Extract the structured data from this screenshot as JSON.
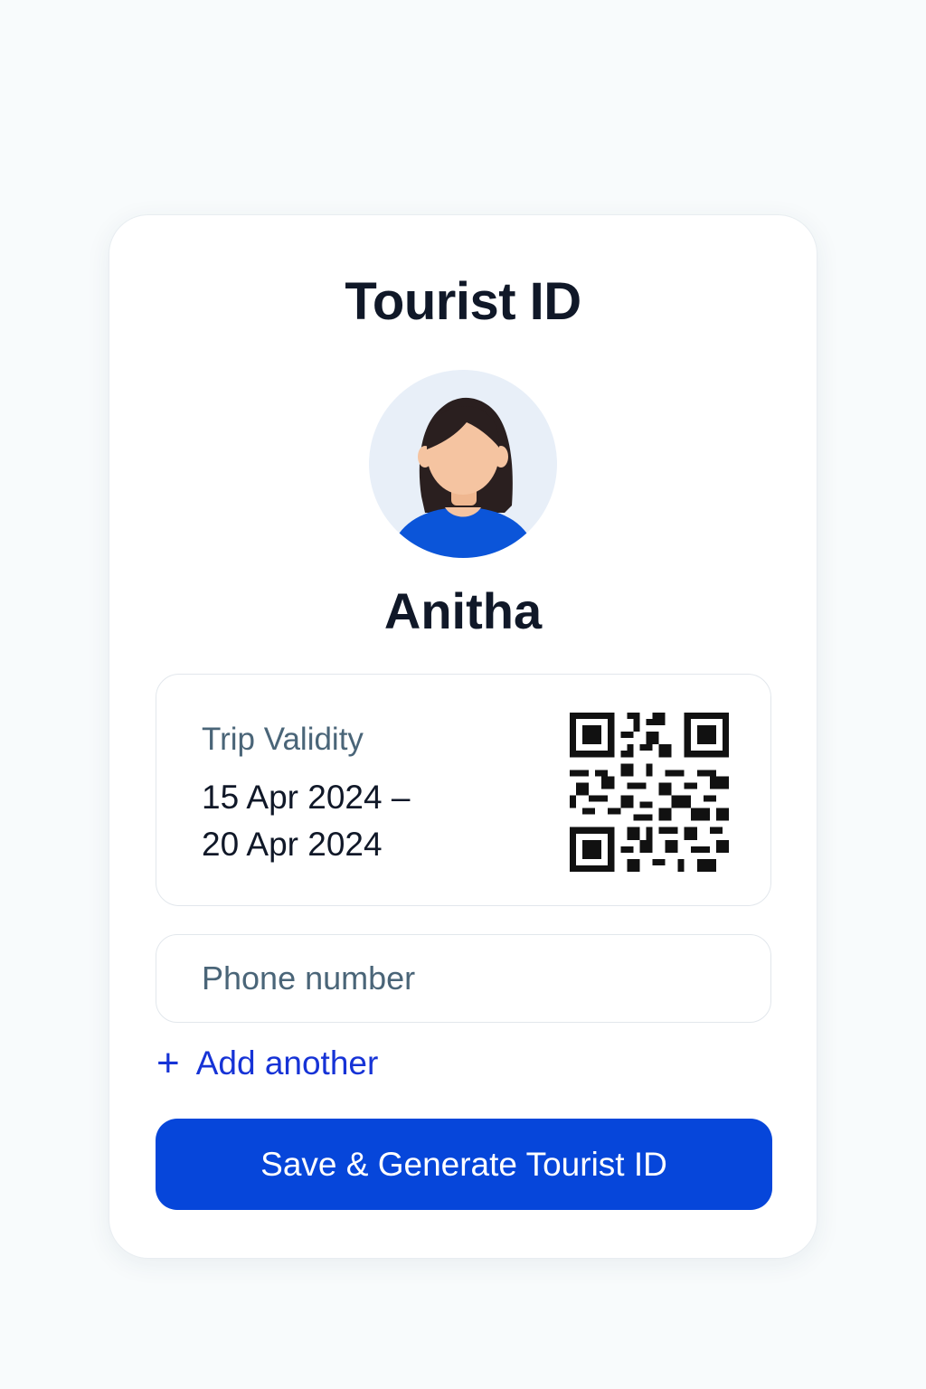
{
  "card": {
    "title": "Tourist ID",
    "user_name": "Anitha"
  },
  "trip": {
    "label": "Trip Validity",
    "start_line": "15 Apr 2024 –",
    "end_line": "20 Apr 2024"
  },
  "phone": {
    "placeholder": "Phone number",
    "value": ""
  },
  "actions": {
    "add_another_icon": "plus-icon",
    "add_another_label": "Add another",
    "save_label": "Save & Generate Tourist ID"
  },
  "colors": {
    "accent": "#0646da",
    "link": "#1633d6",
    "text": "#101828",
    "muted": "#4a6578",
    "avatar_bg": "#e8eff8"
  }
}
